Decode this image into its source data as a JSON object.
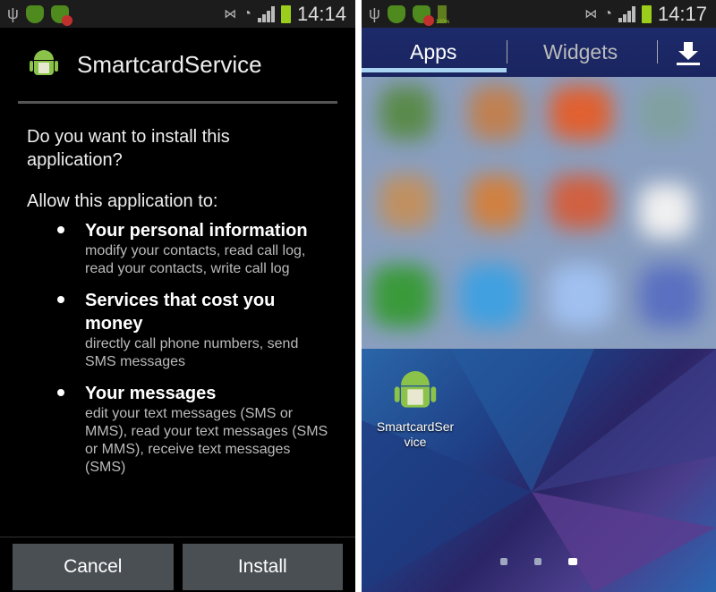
{
  "left": {
    "status": {
      "time": "14:14"
    },
    "app_name": "SmartcardService",
    "question": "Do you want to install this application?",
    "allow_label": "Allow this application to:",
    "permissions": [
      {
        "title": "Your personal information",
        "detail": "modify your contacts, read call log, read your contacts, write call log"
      },
      {
        "title": "Services that cost you money",
        "detail": "directly call phone numbers, send SMS messages"
      },
      {
        "title": "Your messages",
        "detail": "edit your text messages (SMS or MMS), read your text messages (SMS or MMS), receive text messages (SMS)"
      }
    ],
    "cancel_label": "Cancel",
    "install_label": "Install"
  },
  "right": {
    "status": {
      "time": "14:17",
      "battery_notice": "100%"
    },
    "tabs": [
      {
        "label": "Apps",
        "active": true
      },
      {
        "label": "Widgets",
        "active": false
      }
    ],
    "download_icon": "download-icon",
    "app_icon_label": "SmartcardSer vice",
    "pages": {
      "count": 3,
      "current": 3
    }
  },
  "colors": {
    "tab_underline": "#a9d3f0",
    "battery": "#9acd1c",
    "android": "#8bc34a"
  }
}
